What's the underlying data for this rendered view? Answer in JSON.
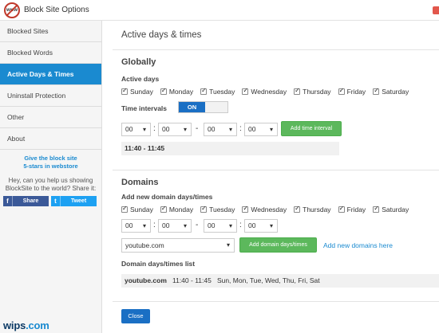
{
  "app": {
    "logo_text": "www",
    "title": "Block Site Options"
  },
  "sidebar": {
    "items": [
      {
        "label": "Blocked Sites"
      },
      {
        "label": "Blocked Words"
      },
      {
        "label": "Active Days & Times"
      },
      {
        "label": "Uninstall Protection"
      },
      {
        "label": "Other"
      },
      {
        "label": "About"
      }
    ],
    "active_index": 2,
    "promo_line1": "Give the block site",
    "promo_line2": "5-stars in webstore",
    "share_text": "Hey, can you help us showing BlockSite to the world? Share it:",
    "facebook": {
      "icon": "f",
      "label": "Share"
    },
    "twitter": {
      "icon": "t",
      "label": "Tweet"
    }
  },
  "watermark": {
    "brand": "wips",
    "suffix": ".com"
  },
  "main": {
    "title": "Active days & times",
    "globally": {
      "heading": "Globally",
      "active_days_label": "Active days",
      "days": [
        "Sunday",
        "Monday",
        "Tuesday",
        "Wednesday",
        "Thursday",
        "Friday",
        "Saturday"
      ],
      "time_intervals_label": "Time intervals",
      "toggle_label": "ON",
      "from_hour": "00",
      "from_min": "00",
      "to_hour": "00",
      "to_min": "00",
      "add_button": "Add time interval",
      "interval": "11:40 - 11:45"
    },
    "domains": {
      "heading": "Domains",
      "add_label": "Add new domain days/times",
      "days": [
        "Sunday",
        "Monday",
        "Tuesday",
        "Wednesday",
        "Thursday",
        "Friday",
        "Saturday"
      ],
      "from_hour": "00",
      "from_min": "00",
      "to_hour": "00",
      "to_min": "00",
      "domain_value": "youtube.com",
      "add_button": "Add domain days/times",
      "add_link": "Add new domains here",
      "list_label": "Domain days/times list",
      "entry": {
        "domain": "youtube.com",
        "time": "11:40 - 11:45",
        "days": "Sun, Mon, Tue, Wed, Thu, Fri, Sat"
      }
    },
    "close_button": "Close"
  },
  "colors": {
    "accent": "#1a8ad0",
    "toggle": "#1a6fc4",
    "green": "#5cb85c",
    "facebook": "#3b5998",
    "twitter": "#1da1f2"
  },
  "icons": {
    "logo": "blocksite-logo-icon",
    "checkbox": "checkmark-icon",
    "dropdown": "chevron-down-icon"
  }
}
